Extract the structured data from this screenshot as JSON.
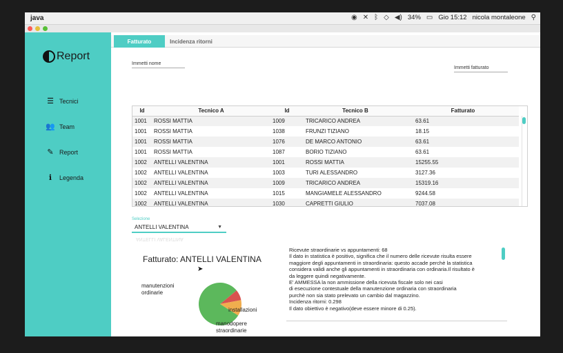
{
  "menubar": {
    "app_name": "java",
    "battery": "34%",
    "datetime": "Gio 15:12",
    "user": "nicola montaleone"
  },
  "sidebar": {
    "logo_text": "Report",
    "items": [
      {
        "label": "Tecnici",
        "icon": "list-icon"
      },
      {
        "label": "Team",
        "icon": "users-icon"
      },
      {
        "label": "Report",
        "icon": "pencil-icon"
      },
      {
        "label": "Legenda",
        "icon": "info-icon"
      }
    ]
  },
  "tabs": [
    {
      "label": "Fatturato",
      "active": true
    },
    {
      "label": "Incidenza ritorni",
      "active": false
    }
  ],
  "fields": {
    "name_placeholder": "Immetti nome",
    "fatturato_placeholder": "Immetti fatturato"
  },
  "table": {
    "headers": [
      "Id",
      "Tecnico A",
      "Id",
      "Tecnico B",
      "Fatturato"
    ],
    "rows": [
      [
        "1001",
        "ROSSI MATTIA",
        "1009",
        "TRICARICO ANDREA",
        "63.61"
      ],
      [
        "1001",
        "ROSSI MATTIA",
        "1038",
        "FRUNZI TIZIANO",
        "18.15"
      ],
      [
        "1001",
        "ROSSI MATTIA",
        "1076",
        "DE MARCO ANTONIO",
        "63.61"
      ],
      [
        "1001",
        "ROSSI MATTIA",
        "1087",
        "BORIO TIZIANO",
        "63.61"
      ],
      [
        "1002",
        "ANTELLI VALENTINA",
        "1001",
        "ROSSI MATTIA",
        "15255.55"
      ],
      [
        "1002",
        "ANTELLI VALENTINA",
        "1003",
        "TURI ALESSANDRO",
        "3127.36"
      ],
      [
        "1002",
        "ANTELLI VALENTINA",
        "1009",
        "TRICARICO ANDREA",
        "15319.16"
      ],
      [
        "1002",
        "ANTELLI VALENTINA",
        "1015",
        "MANGIAMELE ALESSANDRO",
        "9244.58"
      ],
      [
        "1002",
        "ANTELLI VALENTINA",
        "1030",
        "CAPRETTI GIULIO",
        "7037.08"
      ]
    ]
  },
  "selection": {
    "label": "Selezione",
    "value": "ANTELLI VALENTINA"
  },
  "chart_data": {
    "type": "pie",
    "title": "Fatturato: ANTELLI VALENTINA",
    "slices": [
      {
        "label": "manutenzioni ordinarie",
        "value": 80,
        "color": "#5cb85c"
      },
      {
        "label": "installazioni",
        "value": 8,
        "color": "#d9534f"
      },
      {
        "label": "manodopere straordinarie",
        "value": 12,
        "color": "#f0ad4e"
      }
    ]
  },
  "info_lines": [
    "Ricevute straordinarie vs appuntamenti: 68",
    "Il dato in statistica è positivo, significa che il numero delle ricevute risulta essere",
    "maggiore degli appuntamenti in straordinaria: questo accade perchè la statistica",
    "considera validi anche gli appuntamenti in straordinaria con ordinaria.Il risultato è",
    "da leggere quindi negativamente.",
    "E' AMMESSA la non ammissione della ricevuta fiscale solo nei casi",
    "di esecuzione contestuale della manutenzione ordinaria con straordinaria",
    "purchè non sia stato prelevato un cambio dal magazzino.",
    "Incidenza ritorni: 0.298",
    "Il dato obiettivo è negativo(deve essere minore di 0.25)."
  ]
}
